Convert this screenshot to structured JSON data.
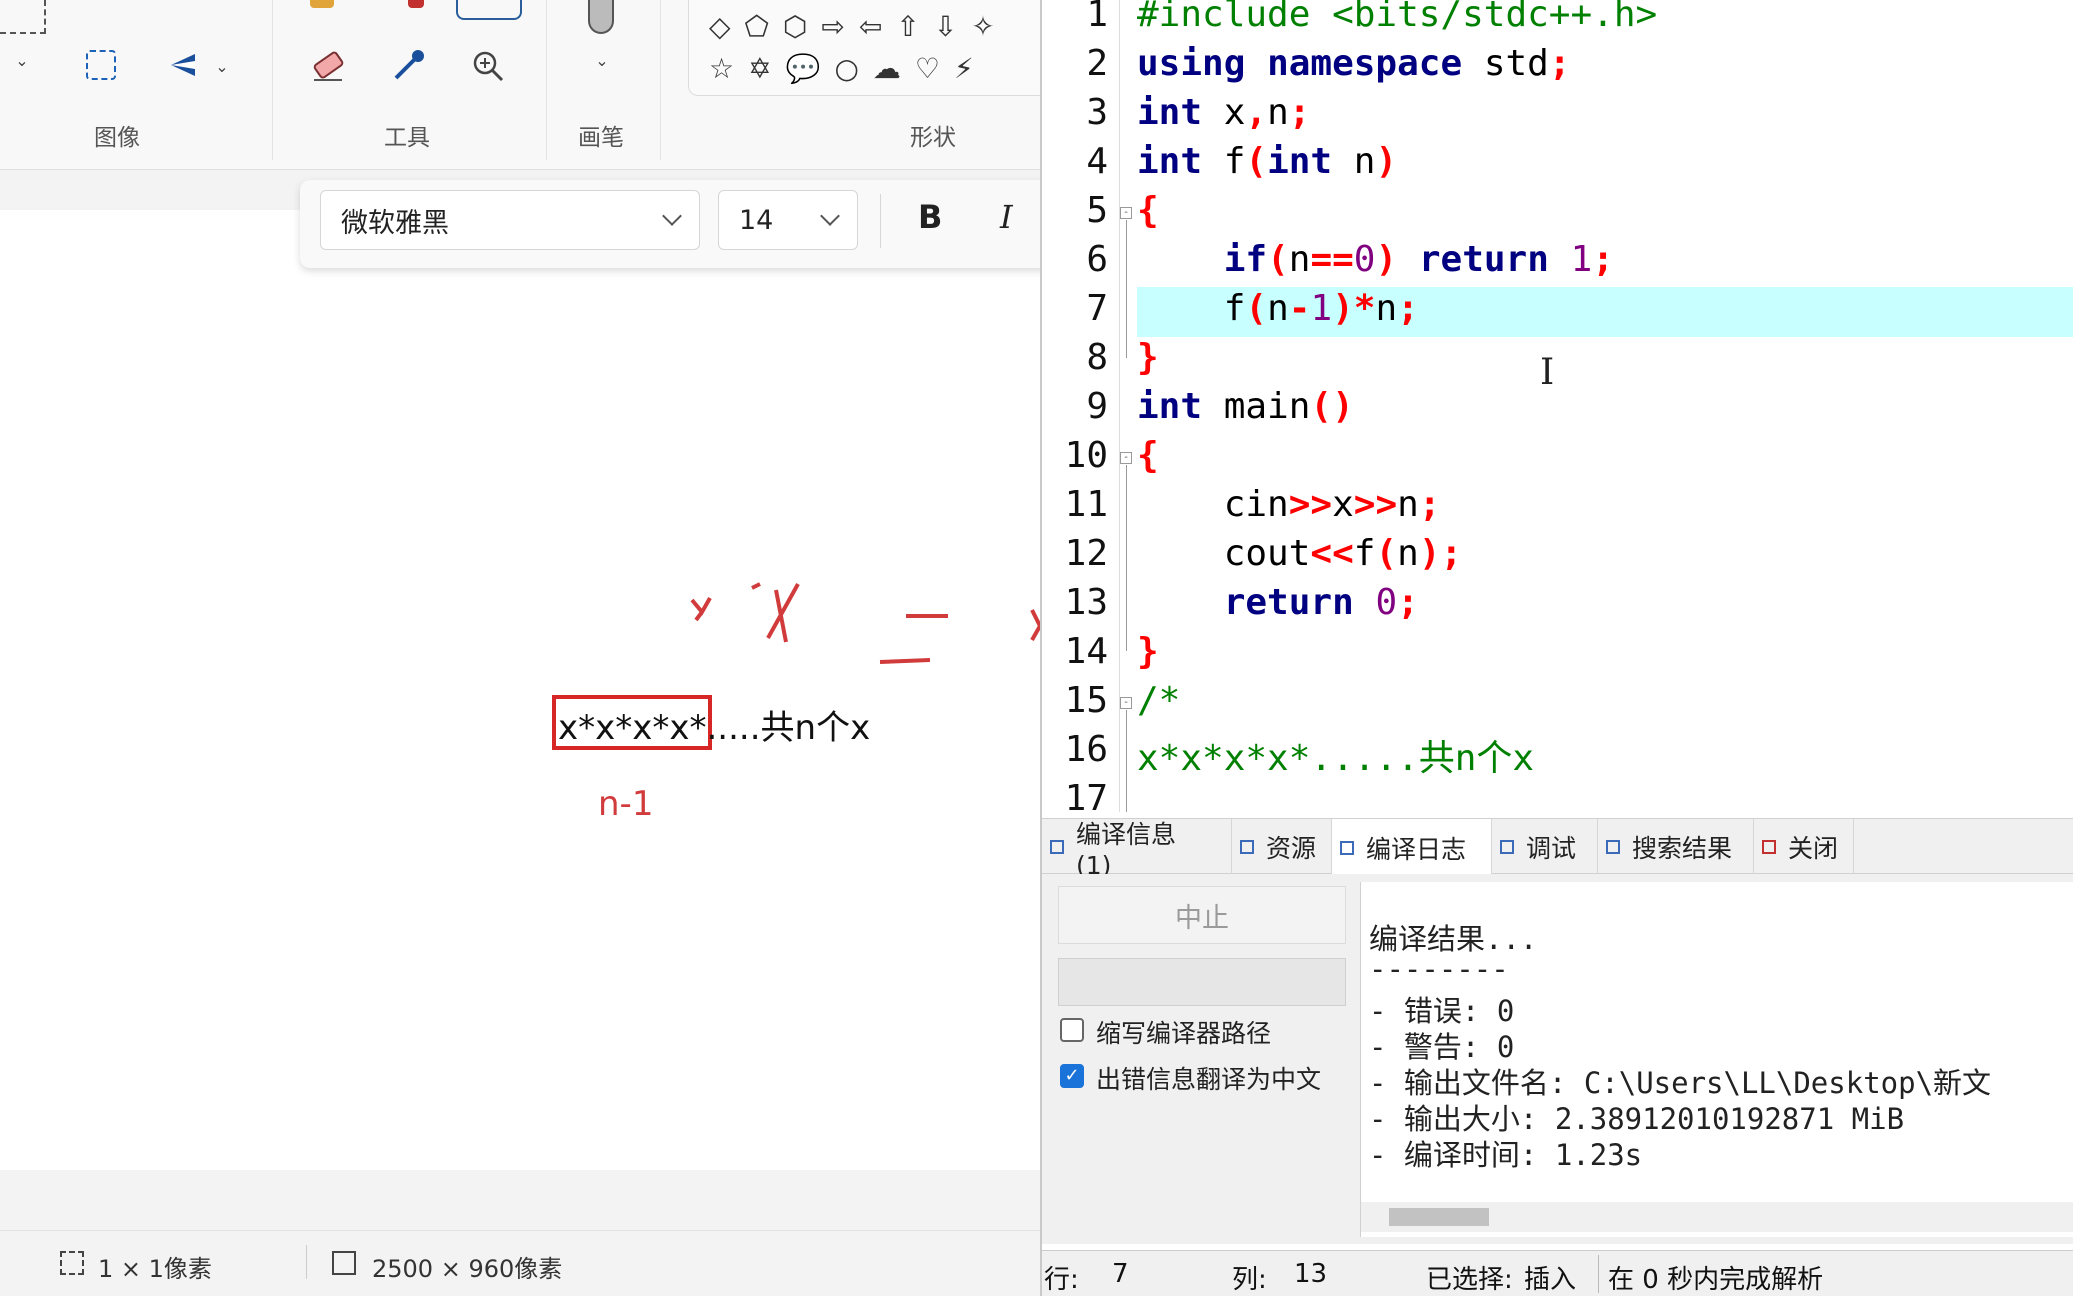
{
  "paint": {
    "ribbon": {
      "groups": {
        "image": "图像",
        "tools": "工具",
        "brushes": "画笔",
        "shapes": "形状"
      },
      "tool_icons": [
        "eraser-icon",
        "color-picker-icon",
        "magnifier-icon"
      ],
      "shape_icons_row1": [
        "◇",
        "⬠",
        "⬡",
        "⇨",
        "⇦",
        "⇧",
        "⇩",
        "✧"
      ],
      "shape_icons_row2": [
        "☆",
        "✡",
        "💬",
        "○",
        "☁",
        "♡",
        "⚡"
      ]
    },
    "text_toolbar": {
      "font_name": "微软雅黑",
      "font_size": "14",
      "bold_label": "B",
      "italic_label": "I"
    },
    "canvas": {
      "formula_text": "x*x*x*x*.....共n个x",
      "ink_annotation": "n-1",
      "annotation_color": "#d13b3b",
      "box_color": "#d72626"
    },
    "status": {
      "selection_size": "1 × 1像素",
      "canvas_size": "2500 × 960像素"
    }
  },
  "ide": {
    "line_numbers": [
      "1",
      "2",
      "3",
      "4",
      "5",
      "6",
      "7",
      "8",
      "9",
      "10",
      "11",
      "12",
      "13",
      "14",
      "15",
      "16",
      "17"
    ],
    "current_line": 7,
    "highlight_color": "#c8ffff",
    "tabs": [
      {
        "label": "编译信息 (1)",
        "icon": "grid-icon"
      },
      {
        "label": "资源",
        "icon": "resource-icon"
      },
      {
        "label": "编译日志",
        "icon": "bar-chart-icon",
        "active": true
      },
      {
        "label": "调试",
        "icon": "debug-icon"
      },
      {
        "label": "搜索结果",
        "icon": "search-result-icon"
      },
      {
        "label": "关闭",
        "icon": "close-icon"
      }
    ],
    "panel": {
      "stop_button": "中止",
      "check_short_path": "缩写编译器路径",
      "check_short_path_checked": false,
      "check_translate": "出错信息翻译为中文",
      "check_translate_checked": true,
      "log_lines": [
        "编译结果...",
        "--------",
        "- 错误: 0",
        "- 警告: 0",
        "- 输出文件名: C:\\Users\\LL\\Desktop\\新文",
        "- 输出大小: 2.38912010192871 MiB",
        "- 编译时间: 1.23s"
      ]
    },
    "status": {
      "row_label": "行:",
      "row_value": "7",
      "col_label": "列:",
      "col_value": "13",
      "selected_label": "已选择:",
      "mode": "插入",
      "parse_msg": "在 0 秒内完成解析"
    }
  }
}
